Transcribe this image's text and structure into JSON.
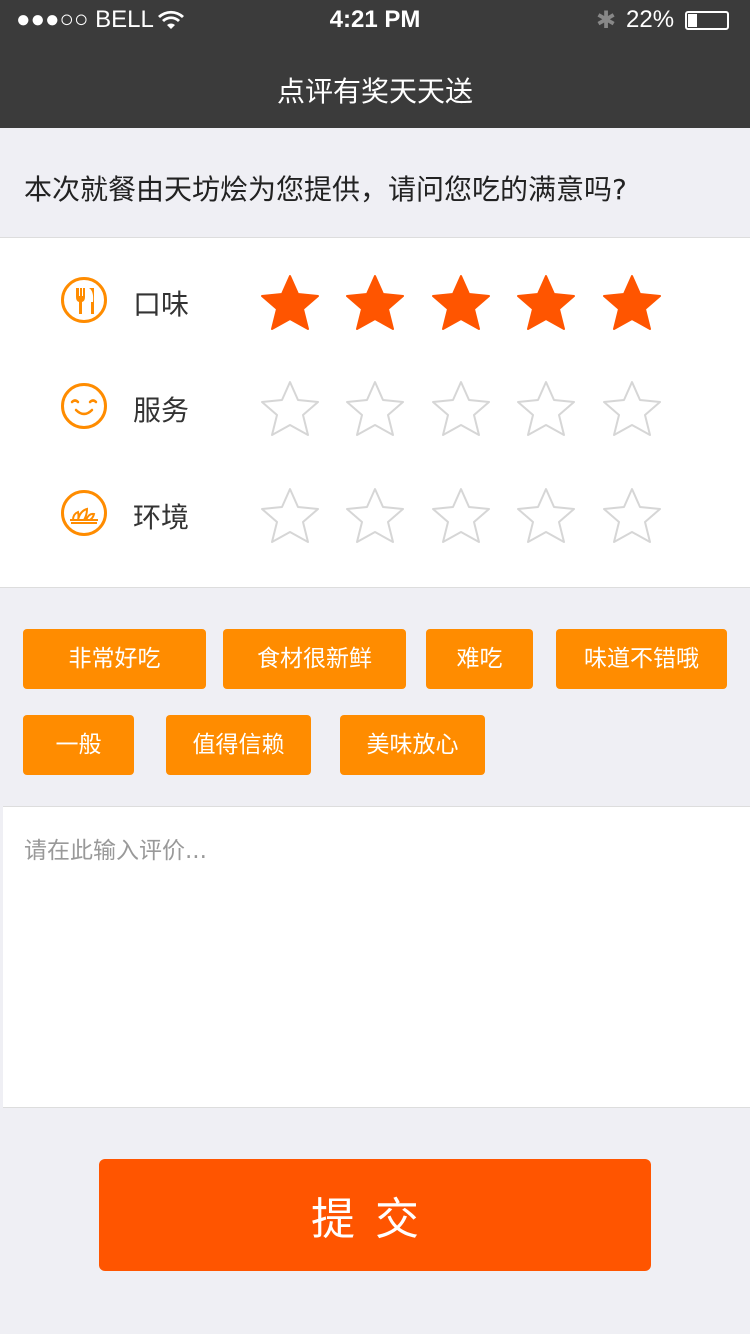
{
  "status": {
    "carrier": "●●●○○ BELL",
    "time": "4:21 PM",
    "battery": "22%"
  },
  "nav": {
    "title": "点评有奖天天送"
  },
  "question": "本次就餐由天坊烩为您提供，请问您吃的满意吗?",
  "ratings": [
    {
      "label": "口味",
      "icon": "utensils-icon",
      "stars": 5,
      "max": 5
    },
    {
      "label": "服务",
      "icon": "smile-icon",
      "stars": 0,
      "max": 5
    },
    {
      "label": "环境",
      "icon": "opera-house-icon",
      "stars": 0,
      "max": 5
    }
  ],
  "tags": [
    "非常好吃",
    "食材很新鲜",
    "难吃",
    "味道不错哦",
    "一般",
    "值得信赖",
    "美味放心"
  ],
  "comment": {
    "placeholder": "请在此输入评价...",
    "value": ""
  },
  "submit_label": "提交",
  "colors": {
    "star_on": "#ff5500",
    "star_off": "#d6d6d6",
    "tag": "#ff8c00",
    "submit": "#ff5500"
  }
}
